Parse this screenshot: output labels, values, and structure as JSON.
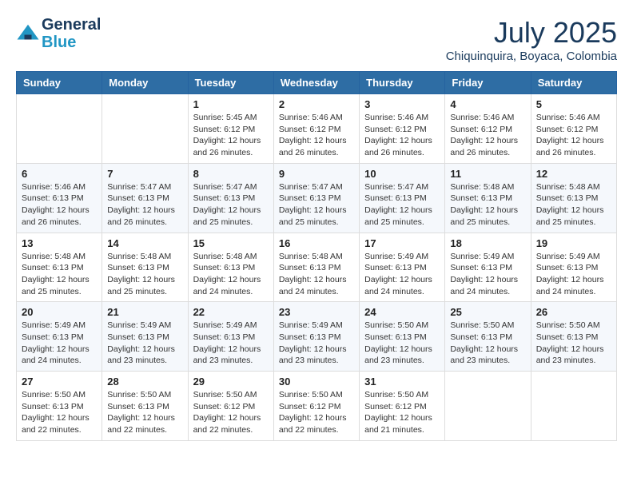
{
  "header": {
    "logo_line1": "General",
    "logo_line2": "Blue",
    "month_title": "July 2025",
    "location": "Chiquinquira, Boyaca, Colombia"
  },
  "weekdays": [
    "Sunday",
    "Monday",
    "Tuesday",
    "Wednesday",
    "Thursday",
    "Friday",
    "Saturday"
  ],
  "weeks": [
    [
      {
        "day": "",
        "info": ""
      },
      {
        "day": "",
        "info": ""
      },
      {
        "day": "1",
        "info": "Sunrise: 5:45 AM\nSunset: 6:12 PM\nDaylight: 12 hours and 26 minutes."
      },
      {
        "day": "2",
        "info": "Sunrise: 5:46 AM\nSunset: 6:12 PM\nDaylight: 12 hours and 26 minutes."
      },
      {
        "day": "3",
        "info": "Sunrise: 5:46 AM\nSunset: 6:12 PM\nDaylight: 12 hours and 26 minutes."
      },
      {
        "day": "4",
        "info": "Sunrise: 5:46 AM\nSunset: 6:12 PM\nDaylight: 12 hours and 26 minutes."
      },
      {
        "day": "5",
        "info": "Sunrise: 5:46 AM\nSunset: 6:12 PM\nDaylight: 12 hours and 26 minutes."
      }
    ],
    [
      {
        "day": "6",
        "info": "Sunrise: 5:46 AM\nSunset: 6:13 PM\nDaylight: 12 hours and 26 minutes."
      },
      {
        "day": "7",
        "info": "Sunrise: 5:47 AM\nSunset: 6:13 PM\nDaylight: 12 hours and 26 minutes."
      },
      {
        "day": "8",
        "info": "Sunrise: 5:47 AM\nSunset: 6:13 PM\nDaylight: 12 hours and 25 minutes."
      },
      {
        "day": "9",
        "info": "Sunrise: 5:47 AM\nSunset: 6:13 PM\nDaylight: 12 hours and 25 minutes."
      },
      {
        "day": "10",
        "info": "Sunrise: 5:47 AM\nSunset: 6:13 PM\nDaylight: 12 hours and 25 minutes."
      },
      {
        "day": "11",
        "info": "Sunrise: 5:48 AM\nSunset: 6:13 PM\nDaylight: 12 hours and 25 minutes."
      },
      {
        "day": "12",
        "info": "Sunrise: 5:48 AM\nSunset: 6:13 PM\nDaylight: 12 hours and 25 minutes."
      }
    ],
    [
      {
        "day": "13",
        "info": "Sunrise: 5:48 AM\nSunset: 6:13 PM\nDaylight: 12 hours and 25 minutes."
      },
      {
        "day": "14",
        "info": "Sunrise: 5:48 AM\nSunset: 6:13 PM\nDaylight: 12 hours and 25 minutes."
      },
      {
        "day": "15",
        "info": "Sunrise: 5:48 AM\nSunset: 6:13 PM\nDaylight: 12 hours and 24 minutes."
      },
      {
        "day": "16",
        "info": "Sunrise: 5:48 AM\nSunset: 6:13 PM\nDaylight: 12 hours and 24 minutes."
      },
      {
        "day": "17",
        "info": "Sunrise: 5:49 AM\nSunset: 6:13 PM\nDaylight: 12 hours and 24 minutes."
      },
      {
        "day": "18",
        "info": "Sunrise: 5:49 AM\nSunset: 6:13 PM\nDaylight: 12 hours and 24 minutes."
      },
      {
        "day": "19",
        "info": "Sunrise: 5:49 AM\nSunset: 6:13 PM\nDaylight: 12 hours and 24 minutes."
      }
    ],
    [
      {
        "day": "20",
        "info": "Sunrise: 5:49 AM\nSunset: 6:13 PM\nDaylight: 12 hours and 24 minutes."
      },
      {
        "day": "21",
        "info": "Sunrise: 5:49 AM\nSunset: 6:13 PM\nDaylight: 12 hours and 23 minutes."
      },
      {
        "day": "22",
        "info": "Sunrise: 5:49 AM\nSunset: 6:13 PM\nDaylight: 12 hours and 23 minutes."
      },
      {
        "day": "23",
        "info": "Sunrise: 5:49 AM\nSunset: 6:13 PM\nDaylight: 12 hours and 23 minutes."
      },
      {
        "day": "24",
        "info": "Sunrise: 5:50 AM\nSunset: 6:13 PM\nDaylight: 12 hours and 23 minutes."
      },
      {
        "day": "25",
        "info": "Sunrise: 5:50 AM\nSunset: 6:13 PM\nDaylight: 12 hours and 23 minutes."
      },
      {
        "day": "26",
        "info": "Sunrise: 5:50 AM\nSunset: 6:13 PM\nDaylight: 12 hours and 23 minutes."
      }
    ],
    [
      {
        "day": "27",
        "info": "Sunrise: 5:50 AM\nSunset: 6:13 PM\nDaylight: 12 hours and 22 minutes."
      },
      {
        "day": "28",
        "info": "Sunrise: 5:50 AM\nSunset: 6:13 PM\nDaylight: 12 hours and 22 minutes."
      },
      {
        "day": "29",
        "info": "Sunrise: 5:50 AM\nSunset: 6:12 PM\nDaylight: 12 hours and 22 minutes."
      },
      {
        "day": "30",
        "info": "Sunrise: 5:50 AM\nSunset: 6:12 PM\nDaylight: 12 hours and 22 minutes."
      },
      {
        "day": "31",
        "info": "Sunrise: 5:50 AM\nSunset: 6:12 PM\nDaylight: 12 hours and 21 minutes."
      },
      {
        "day": "",
        "info": ""
      },
      {
        "day": "",
        "info": ""
      }
    ]
  ]
}
